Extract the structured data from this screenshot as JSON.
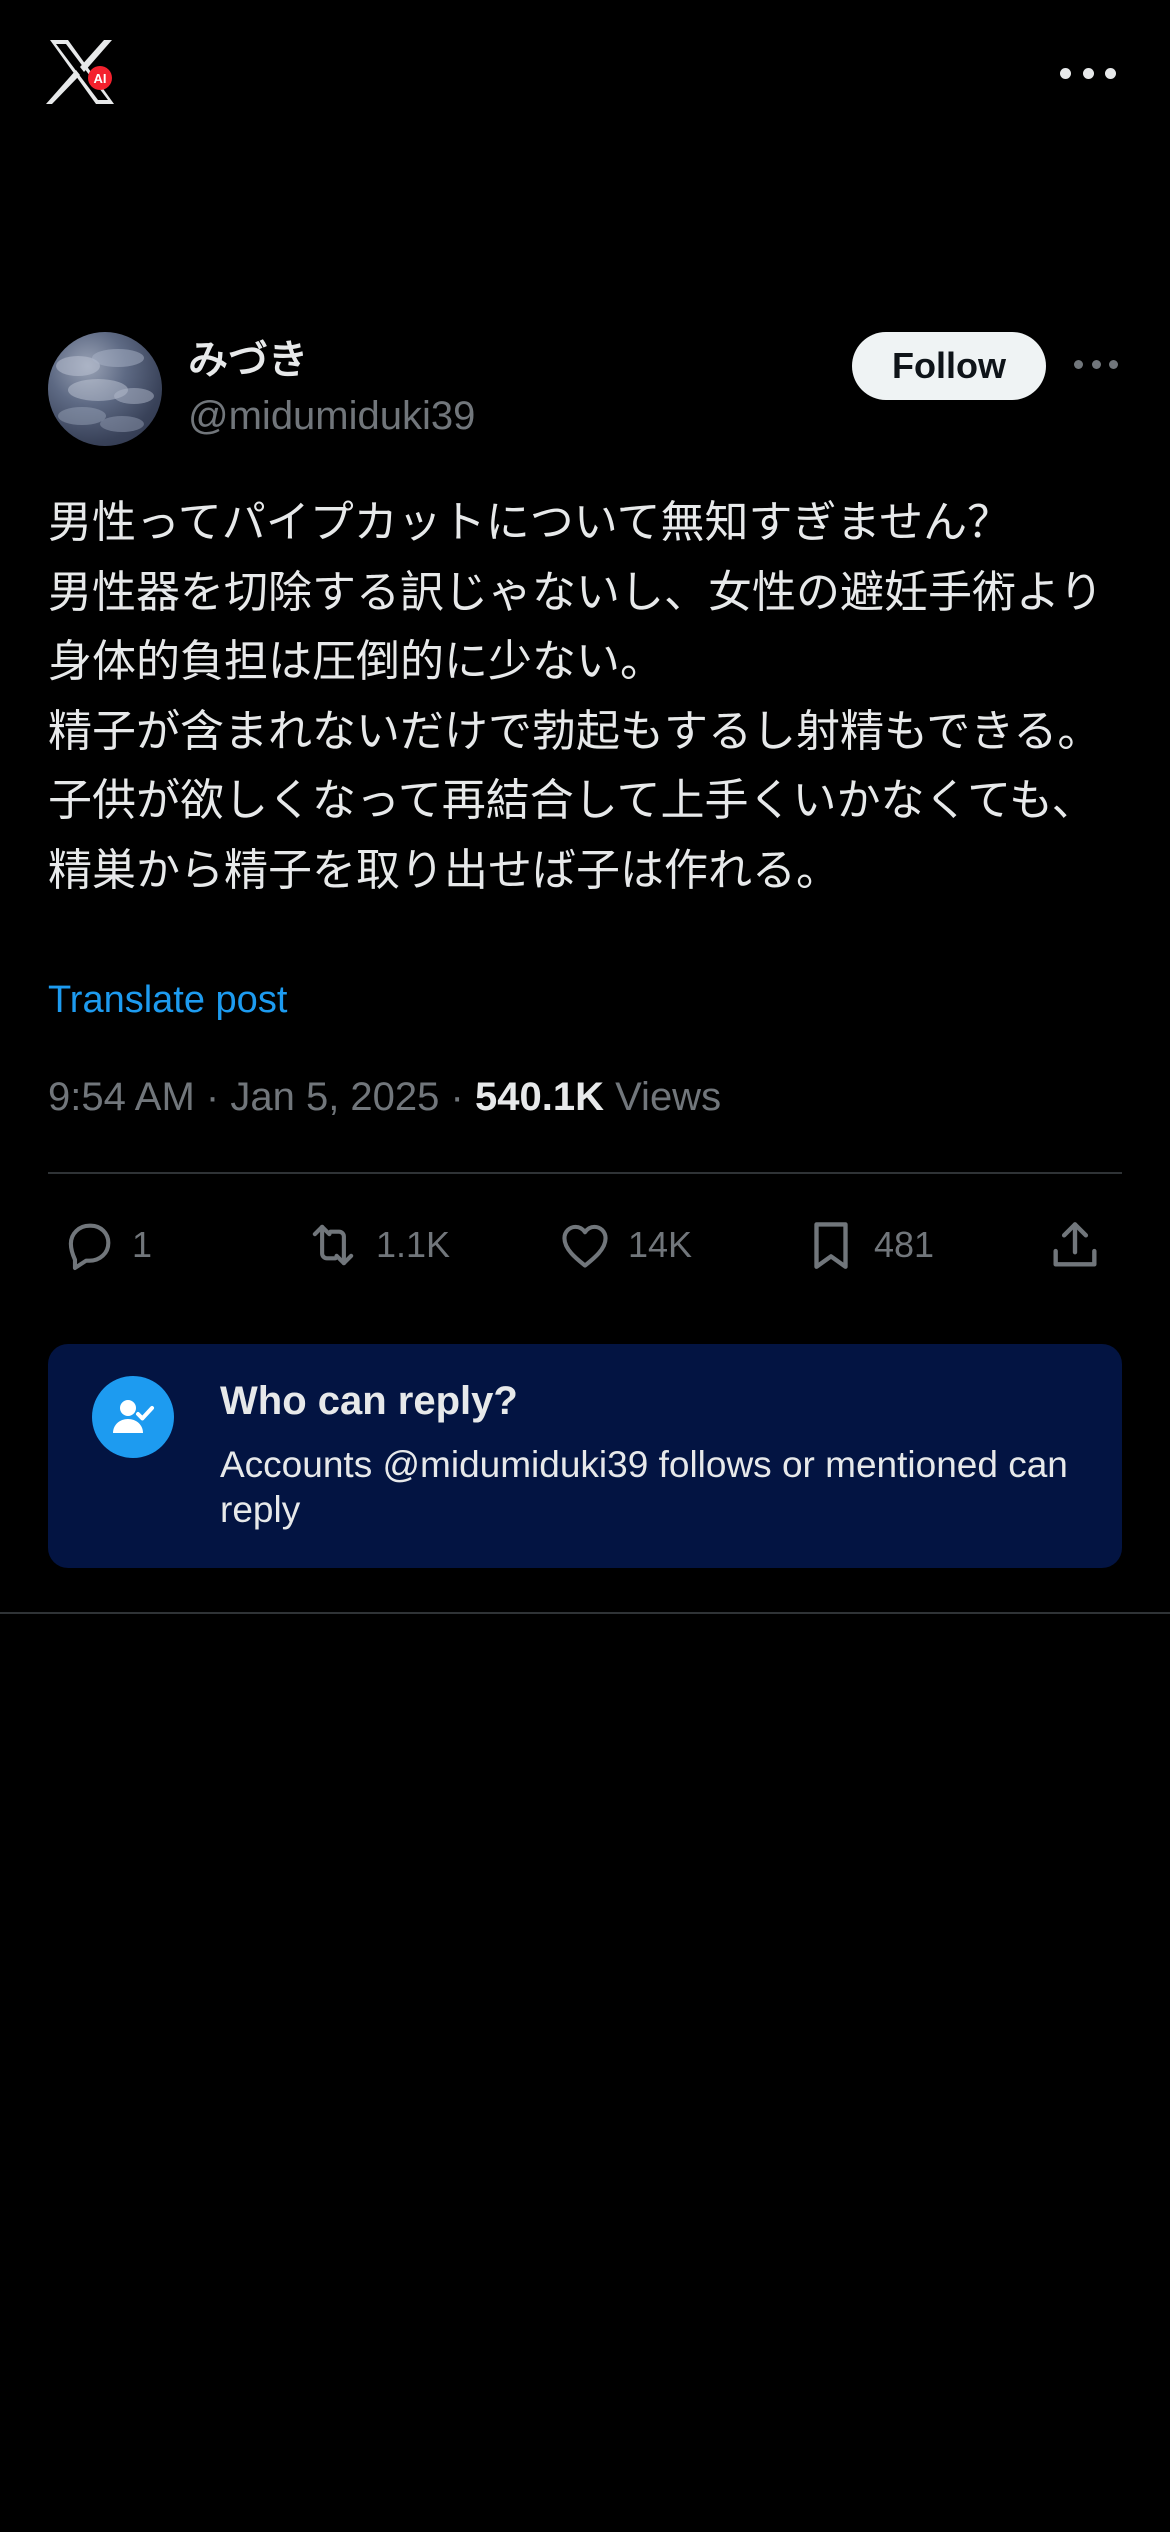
{
  "app": {
    "logo_icon": "x-logo-icon",
    "logo_badge_text": "AI",
    "more_icon": "more-horizontal-icon"
  },
  "post": {
    "author": {
      "display_name": "みづき",
      "handle": "@midumiduki39",
      "follow_label": "Follow"
    },
    "text": "男性ってパイプカットについて無知すぎません？\n男性器を切除する訳じゃないし、女性の避妊手術より身体的負担は圧倒的に少ない。\n精子が含まれないだけで勃起もするし射精もできる。\n子供が欲しくなって再結合して上手くいかなくても、精巣から精子を取り出せば子は作れる。",
    "translate_label": "Translate post",
    "time": "9:54 AM",
    "separator": "·",
    "date": "Jan 5, 2025",
    "views_count": "540.1K",
    "views_label": "Views"
  },
  "actions": {
    "reply_count": "1",
    "repost_count": "1.1K",
    "like_count": "14K",
    "bookmark_count": "481"
  },
  "reply_restriction": {
    "title": "Who can reply?",
    "description": "Accounts @midumiduki39 follows or mentioned can reply"
  },
  "colors": {
    "background": "#000000",
    "text_primary": "#e7e9ea",
    "text_secondary": "#71767b",
    "accent": "#1d9bf0",
    "reply_box_bg": "#031442",
    "divider": "#2f3336"
  }
}
